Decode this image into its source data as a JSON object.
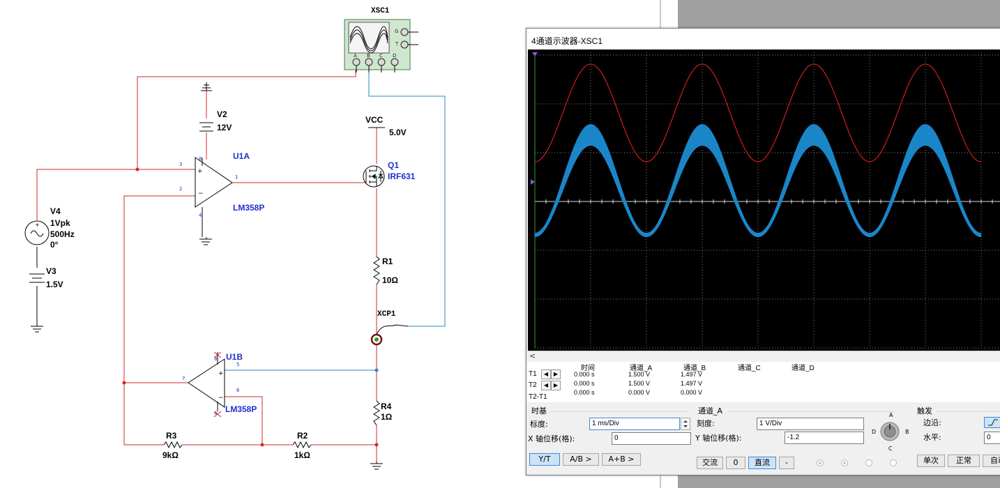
{
  "schematic": {
    "scope_ref": "XSC1",
    "scope_pins": [
      "A",
      "B",
      "C",
      "D"
    ],
    "scope_side_pins": [
      "G",
      "T"
    ],
    "v2": {
      "name": "V2",
      "value": "12V"
    },
    "u1a": {
      "name": "U1A",
      "model": "LM358P",
      "pin_plus": "3",
      "pin_minus": "2",
      "pin_out": "1",
      "pin_vp": "8",
      "pin_vn": "4"
    },
    "vcc": {
      "name": "VCC",
      "value": "5.0V"
    },
    "q1": {
      "name": "Q1",
      "model": "IRF631"
    },
    "v4": {
      "name": "V4",
      "amp": "1Vpk",
      "freq": "500Hz",
      "phase": "0°"
    },
    "v3": {
      "name": "V3",
      "value": "1.5V"
    },
    "r1": {
      "name": "R1",
      "value": "10Ω"
    },
    "probe": {
      "name": "XCP1"
    },
    "u1b": {
      "name": "U1B",
      "model": "LM358P",
      "pin_plus": "5",
      "pin_minus": "6",
      "pin_out": "7",
      "pin_vp": "8",
      "pin_vn": "4"
    },
    "r4": {
      "name": "R4",
      "value": "1Ω"
    },
    "r3": {
      "name": "R3",
      "value": "9kΩ"
    },
    "r2": {
      "name": "R2",
      "value": "1kΩ"
    }
  },
  "scope": {
    "title": "4通道示波器-XSC1",
    "scroll_left": "<",
    "readings": {
      "headers": [
        "时间",
        "通道_A",
        "通道_B",
        "通道_C",
        "通道_D"
      ],
      "rows": [
        {
          "label": "T1",
          "values": [
            "0.000 s",
            "1.500 V",
            "1.497 V"
          ]
        },
        {
          "label": "T2",
          "values": [
            "0.000 s",
            "1.500 V",
            "1.497 V"
          ]
        },
        {
          "label": "T2-T1",
          "values": [
            "0.000 s",
            "0.000 V",
            "0.000 V"
          ]
        }
      ],
      "arrow_left": "◀",
      "arrow_right": "▶"
    },
    "timebase": {
      "title": "时基",
      "scale_label": "标度:",
      "scale_value": "1 ms/Div",
      "xpos_label": "X 轴位移(格):",
      "xpos_value": "0",
      "btn_yt": "Y/T",
      "btn_ab": "A/B >",
      "btn_apb": "A+B >"
    },
    "channel": {
      "title": "通道_A",
      "scale_label": "刻度:",
      "scale_value": "1  V/Div",
      "ypos_label": "Y 轴位移(格):",
      "ypos_value": "-1.2",
      "btn_ac": "交流",
      "btn_zero": "0",
      "btn_dc": "直流",
      "btn_minus": "-",
      "knob": {
        "a": "A",
        "b": "B",
        "c": "C",
        "d": "D"
      }
    },
    "trigger": {
      "title": "触发",
      "edge_label": "边沿:",
      "level_label": "水平:",
      "level_value": "0",
      "btn_single": "单次",
      "btn_normal": "正常",
      "btn_auto": "自动"
    },
    "colors": {
      "channel_a": "#d21e1e",
      "channel_b": "#1a86c8",
      "grid": "#b4b4b4",
      "screen": "#000000"
    },
    "waveform": {
      "frequency_hz": 500,
      "time_per_div_ms": 1,
      "volts_per_div": 1,
      "y_offset_div": -1.2,
      "a_offset_v": 1.5,
      "a_amplitude_v": 1.0,
      "b_offset_v": 1.5,
      "b_amplitude_v": 1.0
    }
  }
}
